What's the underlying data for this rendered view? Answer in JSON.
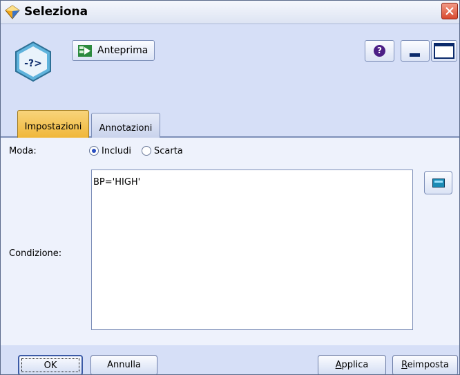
{
  "window": {
    "title": "Seleziona"
  },
  "toolbar": {
    "preview_label": "Anteprima",
    "help_label": "?"
  },
  "node": {
    "symbol": "-?>"
  },
  "tabs": [
    {
      "label": "Impostazioni",
      "active": true
    },
    {
      "label": "Annotazioni",
      "active": false
    }
  ],
  "settings": {
    "mode_label": "Moda:",
    "mode_options": [
      {
        "label": "Includi",
        "selected": true
      },
      {
        "label": "Scarta",
        "selected": false
      }
    ],
    "condition_label": "Condizione:",
    "condition_value": "BP='HIGH'"
  },
  "footer": {
    "ok_label": "OK",
    "cancel_label": "Annulla",
    "apply_label_ul": "A",
    "apply_label_rest": "pplica",
    "reset_label_ul": "R",
    "reset_label_rest": "eimposta"
  },
  "colors": {
    "active_tab": "#f0b73a",
    "node_icon": "#5fb3dc",
    "close_button": "#d8492f"
  }
}
